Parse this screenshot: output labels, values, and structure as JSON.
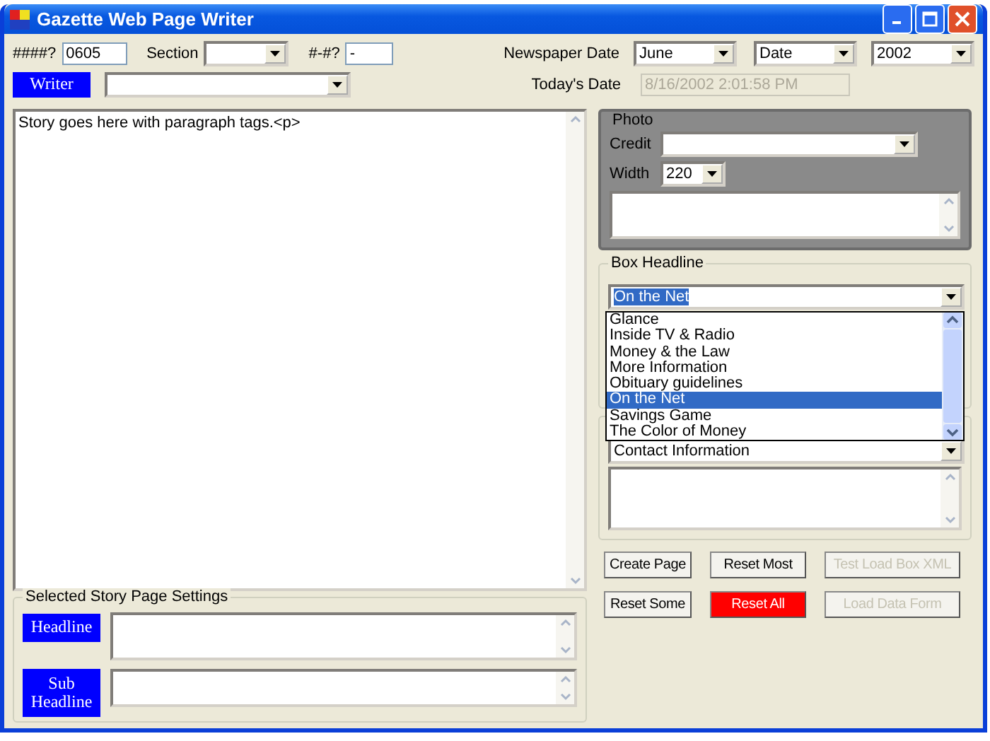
{
  "window": {
    "title": "Gazette Web Page Writer"
  },
  "story_number": {
    "label": "####?",
    "value": "0605"
  },
  "section": {
    "label": "Section"
  },
  "page_number": {
    "label": "#-#?",
    "value": "-"
  },
  "writer": {
    "label": "Writer"
  },
  "newspaper_date": {
    "label": "Newspaper Date",
    "month": "June",
    "day": "Date",
    "year": "2002"
  },
  "todays_date": {
    "label": "Today's Date",
    "value": "8/16/2002 2:01:58 PM",
    "disabled": true
  },
  "story": {
    "value": "Story goes here with paragraph tags.<p>"
  },
  "settings": {
    "title": "Selected Story Page Settings",
    "fields": [
      {
        "label": "Headline"
      },
      {
        "label": "Sub Headline"
      }
    ]
  },
  "photo": {
    "title": "Photo",
    "credit_label": "Credit",
    "width_label": "Width",
    "width_value": "220"
  },
  "box_headline": {
    "title": "Box Headline",
    "value": "On the Net",
    "expanded": true,
    "options": [
      {
        "label": "Glance",
        "selected": false
      },
      {
        "label": "Inside TV & Radio",
        "selected": false
      },
      {
        "label": "Money & the Law",
        "selected": false
      },
      {
        "label": "More Information",
        "selected": false
      },
      {
        "label": "Obituary guidelines",
        "selected": false
      },
      {
        "label": "On the Net",
        "selected": true
      },
      {
        "label": "Savings Game",
        "selected": false
      },
      {
        "label": "The Color of Money",
        "selected": false
      }
    ]
  },
  "contact": {
    "value": "Contact Information"
  },
  "buttons": [
    {
      "label": "Create Page",
      "kind": "normal",
      "disabled": false
    },
    {
      "label": "Reset Most",
      "kind": "normal",
      "disabled": false
    },
    {
      "label": "Test Load Box XML",
      "kind": "normal",
      "disabled": true
    },
    {
      "label": "Reset Some",
      "kind": "normal",
      "disabled": false
    },
    {
      "label": "Reset All",
      "kind": "danger",
      "disabled": false
    },
    {
      "label": "Load Data Form",
      "kind": "normal",
      "disabled": true
    }
  ]
}
